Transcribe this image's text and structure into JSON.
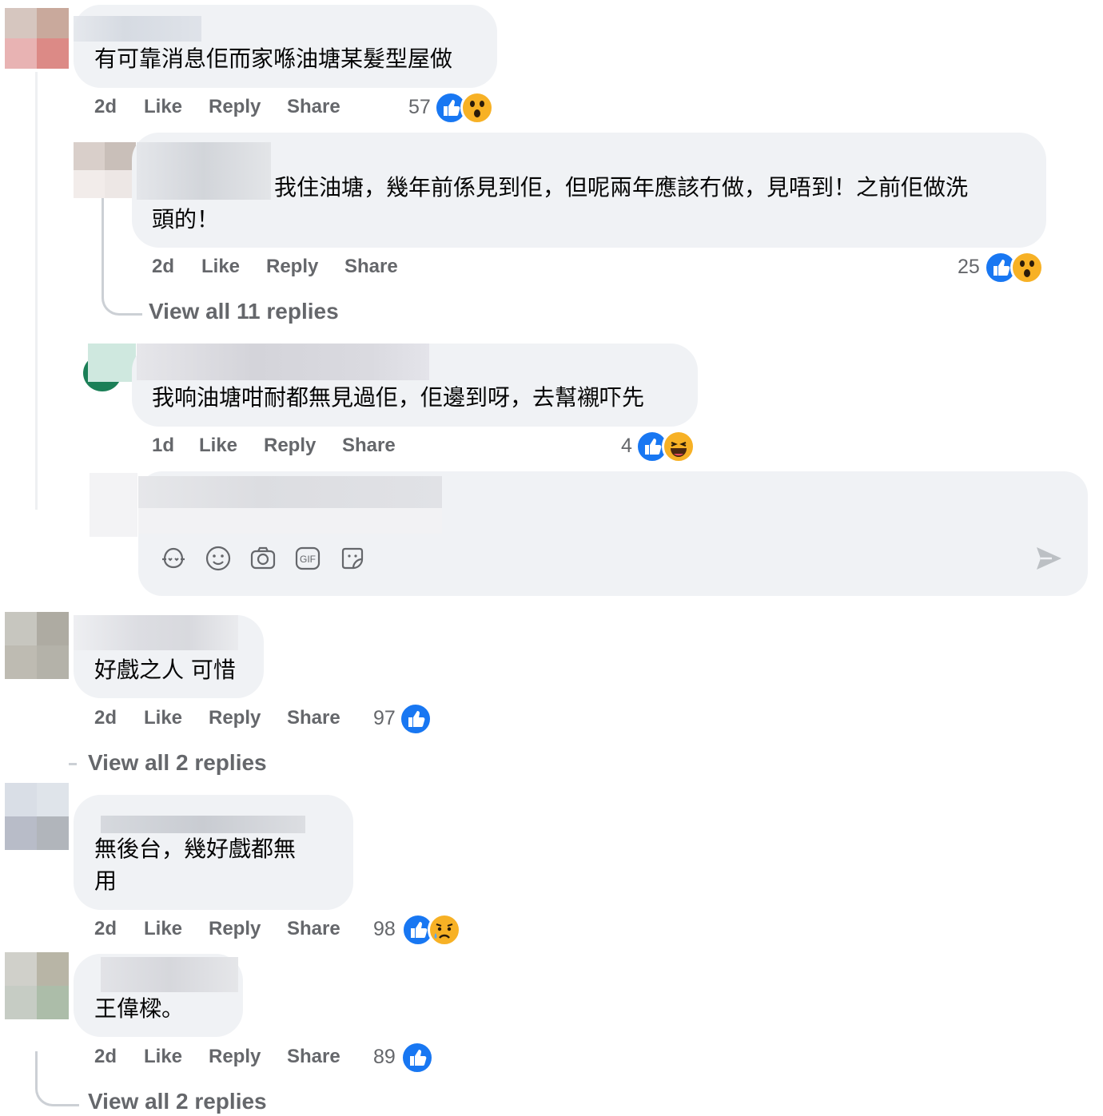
{
  "colors": {
    "bubble": "#f0f2f5",
    "meta": "#65676b",
    "like_blue": "#1877f2",
    "thread": "#ccd0d5"
  },
  "actions": {
    "like": "Like",
    "reply": "Reply",
    "share": "Share"
  },
  "comments": [
    {
      "text": "有可靠消息佢而家喺油塘某髮型屋做",
      "time": "2d",
      "reaction_count": "57",
      "reactions": [
        "like-icon",
        "wow-icon"
      ]
    },
    {
      "text_line1": "我住油塘，幾年前係見到佢，但呢兩年應該冇做，見唔到！之前佢做洗",
      "text_line2": "頭的！",
      "time": "2d",
      "reaction_count": "25",
      "reactions": [
        "like-icon",
        "wow-icon"
      ],
      "view_replies": "View all 11 replies"
    },
    {
      "text": "我响油塘咁耐都無見過佢，佢邊到呀，去幫襯吓先",
      "time": "1d",
      "reaction_count": "4",
      "reactions": [
        "like-icon",
        "haha-icon"
      ]
    },
    {
      "text": "好戲之人 可惜",
      "time": "2d",
      "reaction_count": "97",
      "reactions": [
        "like-icon"
      ],
      "view_replies": "View all 2 replies"
    },
    {
      "text_line1": "無後台，幾好戲都無",
      "text_line2": "用",
      "time": "2d",
      "reaction_count": "98",
      "reactions": [
        "like-icon",
        "sad-icon"
      ]
    },
    {
      "text": "王偉樑。",
      "time": "2d",
      "reaction_count": "89",
      "reactions": [
        "like-icon"
      ],
      "view_replies": "View all 2 replies"
    }
  ],
  "composer": {
    "icons": [
      "avatar-sticker-icon",
      "emoji-icon",
      "camera-icon",
      "gif-icon",
      "sticker-icon",
      "send-icon"
    ],
    "gif_label": "GIF"
  }
}
